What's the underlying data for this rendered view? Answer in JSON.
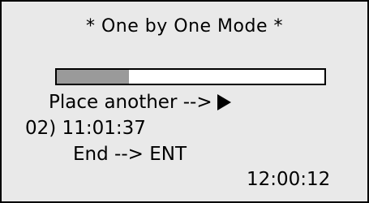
{
  "screen": {
    "title": "* One by One Mode *",
    "progress": {
      "fraction": 0.27
    },
    "place_text": "Place another -->",
    "place_icon": "play-icon",
    "entry_time": "02) 11:01:37",
    "end_text": "End  --> ENT",
    "clock": "12:00:12"
  }
}
